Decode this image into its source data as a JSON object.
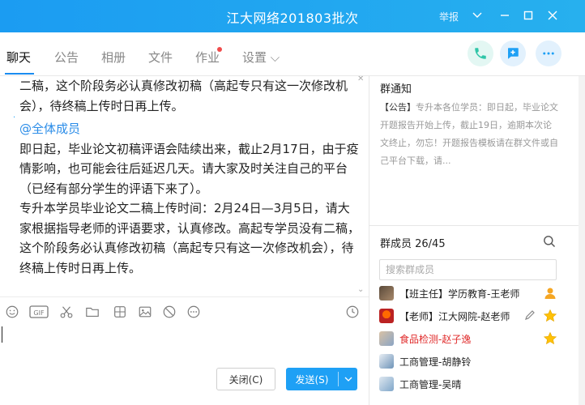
{
  "window": {
    "title": "江大网络201803批次",
    "report_label": "举报",
    "title_bar_color": "#1b9cf2"
  },
  "tabs": [
    {
      "label": "聊天",
      "active": true
    },
    {
      "label": "公告"
    },
    {
      "label": "相册"
    },
    {
      "label": "文件"
    },
    {
      "label": "作业",
      "has_badge": true
    },
    {
      "label": "设置 ⌵"
    }
  ],
  "actions": {
    "call_icon": "phone-icon",
    "add_icon": "add-app-icon",
    "more_icon": "more-icon",
    "call_color": "#2fc5a8",
    "add_color": "#1ea0f5",
    "more_color": "#1ea0f5"
  },
  "chat": {
    "prev_message_tail": "二稿，这个阶段务必认真修改初稿（高起专只有这一次修改机会），待终稿上传时日再上传。",
    "mention": "@全体成员",
    "paragraph1": "即日起，毕业论文初稿评语会陆续出来，截止2月17日，由于疫情影响，也可能会往后延迟几天。请大家及时关注自己的平台（已经有部分学生的评语下来了）。",
    "paragraph2": "专升本学员毕业论文二稿上传时间：2月24日—3月5日，请大家根据指导老师的评语要求，认真修改。高起专学员没有二稿，这个阶段务必认真修改初稿（高起专只有这一次修改机会），待终稿上传时日再上传。"
  },
  "toolbar": {
    "icons": [
      "emoji-icon",
      "gif-icon",
      "scissors-icon",
      "folder-icon",
      "sticker-icon",
      "image-icon",
      "block-icon",
      "more-circle-icon",
      "history-clock-icon"
    ]
  },
  "buttons": {
    "close_label": "关闭(C)",
    "send_label": "发送(S)",
    "send_color": "#1ea0f5"
  },
  "notice": {
    "title": "群通知",
    "tag": "【公告】",
    "text": "专升本各位学员：即日起，毕业论文开题报告开始上传，截止19日，逾期本次论文终止，勿忘！开题报告模板请在群文件或自己平台下载，请..."
  },
  "members": {
    "title": "群成员 26/45",
    "search_placeholder": "搜索群成员",
    "list": [
      {
        "name": "【班主任】学历教育-王老师",
        "name_color": "#222222",
        "badge": "owner-icon"
      },
      {
        "name": "【老师】江大网院-赵老师",
        "name_color": "#222222",
        "badge": "admin-star-icon"
      },
      {
        "name": "食品检测-赵子逸",
        "name_color": "#e02a2a",
        "badge": "admin-star-icon"
      },
      {
        "name": "工商管理-胡静铃",
        "name_color": "#222222"
      },
      {
        "name": "工商管理-吴晴",
        "name_color": "#222222"
      }
    ]
  }
}
